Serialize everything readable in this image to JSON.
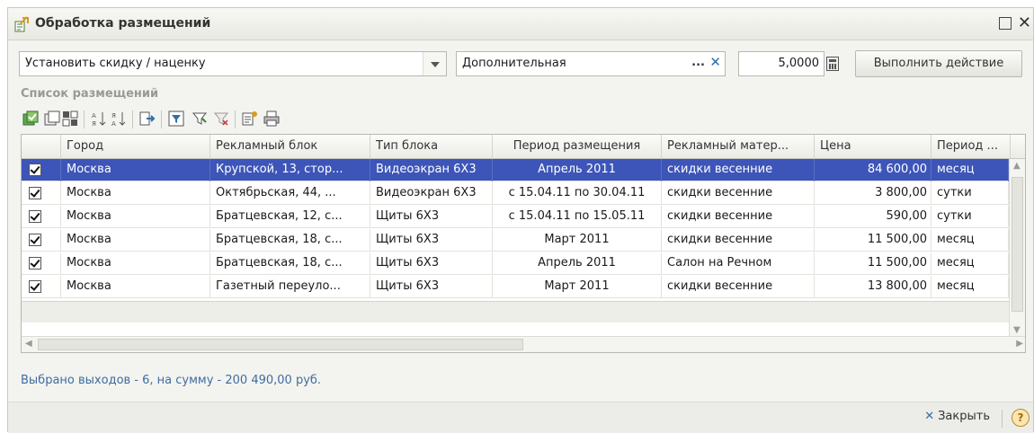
{
  "window": {
    "title": "Обработка размещений"
  },
  "controls": {
    "action": "Установить скидку / наценку",
    "kind": "Дополнительная",
    "kind_dots": "...",
    "amount": "5,0000",
    "execute_label": "Выполнить действие"
  },
  "list": {
    "label": "Список размещений",
    "columns": [
      "Город",
      "Рекламный блок",
      "Тип блока",
      "Период размещения",
      "Рекламный матер...",
      "Цена",
      "Период ..."
    ],
    "rows": [
      {
        "checked": true,
        "city": "Москва",
        "block": "Крупской, 13, стор...",
        "type": "Видеоэкран 6Х3",
        "period": "Апрель 2011",
        "material": "скидки весенние",
        "price": "84 600,00",
        "unit": "месяц"
      },
      {
        "checked": true,
        "city": "Москва",
        "block": "Октябрьская, 44, ...",
        "type": "Видеоэкран 6Х3",
        "period": "с 15.04.11 по 30.04.11",
        "material": "скидки весенние",
        "price": "3 800,00",
        "unit": "сутки"
      },
      {
        "checked": true,
        "city": "Москва",
        "block": "Братцевская, 12, с...",
        "type": "Щиты 6Х3",
        "period": "с 15.04.11 по 15.05.11",
        "material": "скидки весенние",
        "price": "590,00",
        "unit": "сутки"
      },
      {
        "checked": true,
        "city": "Москва",
        "block": "Братцевская, 18, с...",
        "type": "Щиты 6Х3",
        "period": "Март 2011",
        "material": "скидки весенние",
        "price": "11 500,00",
        "unit": "месяц"
      },
      {
        "checked": true,
        "city": "Москва",
        "block": "Братцевская, 18, с...",
        "type": "Щиты 6Х3",
        "period": "Апрель 2011",
        "material": "Салон на Речном",
        "price": "11 500,00",
        "unit": "месяц"
      },
      {
        "checked": true,
        "city": "Москва",
        "block": "Газетный переуло...",
        "type": "Щиты 6Х3",
        "period": "Март 2011",
        "material": "скидки весенние",
        "price": "13 800,00",
        "unit": "месяц"
      }
    ]
  },
  "summary": "Выбрано выходов - 6, на сумму - 200 490,00 руб.",
  "footer": {
    "close_label": "Закрыть",
    "help_label": "?"
  },
  "colors": {
    "selected_row": "#3d55b8",
    "summary_text": "#3f6d9f"
  }
}
